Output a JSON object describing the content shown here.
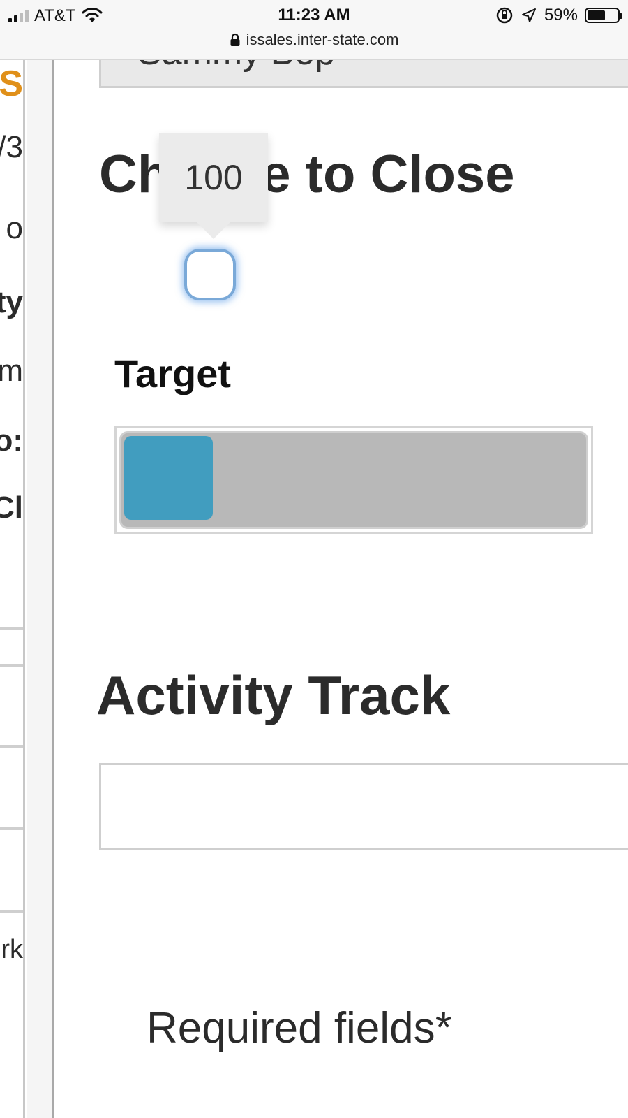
{
  "status_bar": {
    "carrier": "AT&T",
    "time": "11:23 AM",
    "battery": "59%",
    "battery_level": 0.59,
    "url": "issales.inter-state.com"
  },
  "left_fragments": [
    "S",
    "/3",
    "o",
    "ty",
    "m",
    "o:",
    "Cl",
    "rk"
  ],
  "top_field": {
    "text": "Sammy Bop"
  },
  "chance_section": {
    "title": "Chance to Close",
    "tooltip_value": "100"
  },
  "target": {
    "label": "Target",
    "fill_fraction": 0.19,
    "fill_color": "#419dbf"
  },
  "activity": {
    "title": "Activity Track",
    "value": ""
  },
  "footer": {
    "required_text": "Required fields*"
  },
  "colors": {
    "accent_blue": "#419dbf",
    "handle_glow": "#7aa9d8",
    "sidebar_orange": "#e0901a"
  }
}
